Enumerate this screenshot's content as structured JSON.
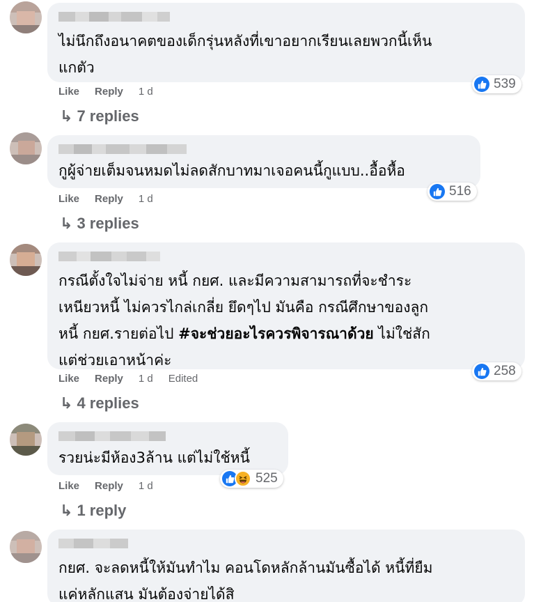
{
  "colors": {
    "bubble": "#f0f2f5",
    "meta": "#65676b",
    "like": "#1877f2",
    "haha": "#f7b125"
  },
  "icons": {
    "like": "like-icon",
    "haha": "haha-icon",
    "reply_arrow": "reply-arrow-icon"
  },
  "comments": [
    {
      "lines": [
        "ไม่นึกถึงอนาคตของเด็กรุ่นหลังที่เขาอยากเรียนเลยพวกนี้เห็น",
        "แกตัว"
      ],
      "reaction_count": "539",
      "like_label": "Like",
      "reply_label": "Reply",
      "time": "1 d",
      "replies_label": "7 replies"
    },
    {
      "lines": [
        "กูผู้จ่ายเต็มจนหมดไม่ลดสักบาทมาเจอคนนี้กูแบบ..อื้อหื้อ"
      ],
      "reaction_count": "516",
      "like_label": "Like",
      "reply_label": "Reply",
      "time": "1 d",
      "replies_label": "3 replies"
    },
    {
      "lines": [
        "กรณีตั้งใจไม่จ่าย หนี้ กยศ. และมีความสามารถที่จะชำระ",
        "เหนียวหนี้ ไม่ควรไกล่เกลี่ย ยึดๆไป มันคือ กรณีศึกษาของลูก"
      ],
      "line3_pre": "หนี้ กยศ.รายต่อไป ",
      "line3_bold": "#จะช่วยอะไรควรพิจารณาด้วย",
      "line3_post": " ไม่ใช่สัก",
      "line4": "แต่ช่วยเอาหน้าค่ะ",
      "reaction_count": "258",
      "like_label": "Like",
      "reply_label": "Reply",
      "time": "1 d",
      "edited_label": "Edited",
      "replies_label": "4 replies"
    },
    {
      "lines": [
        "รวยน่ะมีห้อง3ล้าน แต่ไม่ใช้หนี้"
      ],
      "reaction_count": "525",
      "like_label": "Like",
      "reply_label": "Reply",
      "time": "1 d",
      "replies_label": "1 reply"
    },
    {
      "lines": [
        "กยศ. จะลดหนี้ให้มันทำไม คอนโดหลักล้านมันซื้อได้ หนี้ที่ยืม",
        "แค่หลักแสน มันต้องจ่ายได้สิ"
      ]
    }
  ]
}
